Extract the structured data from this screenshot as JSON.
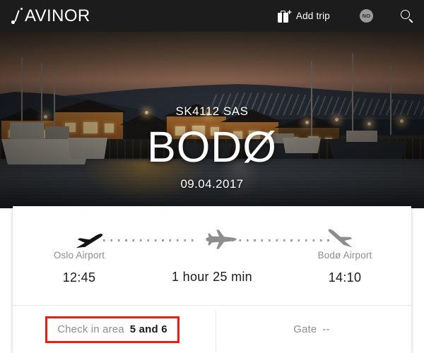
{
  "header": {
    "logo_text": "AVINOR",
    "logo_icon": "avinor-mark-icon",
    "add_trip_label": "Add trip",
    "add_trip_icon": "suitcase-plus-icon",
    "locale_badge": "NO",
    "search_icon": "search-icon",
    "background_color": "#1c1c1c"
  },
  "hero": {
    "flight_code": "SK4112 SAS",
    "destination": "BODØ",
    "date": "09.04.2017",
    "image_description": "Nordic harbour at dusk with lit wooden houses, fishing boats and snow-streaked hills"
  },
  "route": {
    "depart_icon": "airplane-takeoff-icon",
    "cruise_icon": "airplane-cruise-icon",
    "arrive_icon": "airplane-landing-icon",
    "origin": {
      "airport": "Oslo Airport",
      "time": "12:45"
    },
    "duration": {
      "label": "1 hour 25 min"
    },
    "destination": {
      "airport": "Bodø Airport",
      "time": "14:10"
    }
  },
  "details": {
    "check_in": {
      "label": "Check in area",
      "value": "5 and 6",
      "highlight_color": "#ee1c13"
    },
    "gate": {
      "label": "Gate",
      "value": "--"
    }
  }
}
